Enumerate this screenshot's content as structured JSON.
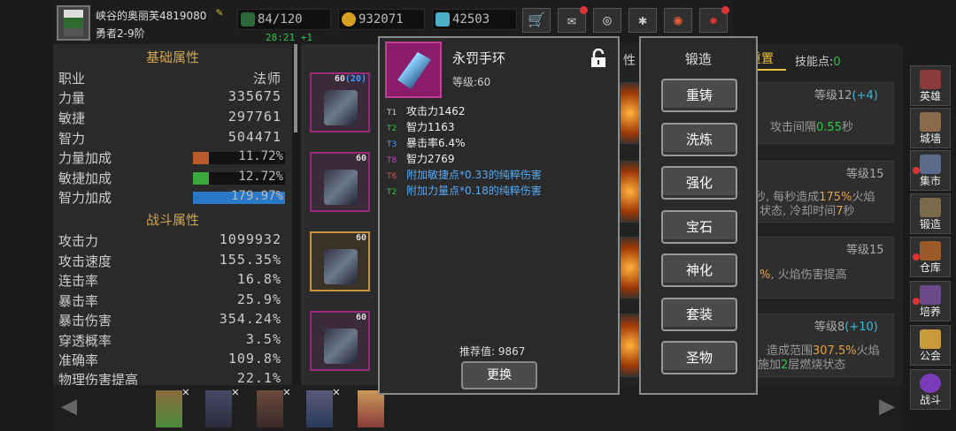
{
  "player": {
    "name": "峡谷的奥丽芙4819080",
    "rank": "勇者2-9阶"
  },
  "resources": {
    "stamina": "84/120",
    "timer": "28:21 +1",
    "gold": "932071",
    "gems": "42503"
  },
  "left": {
    "basic_title": "基础属性",
    "class_key": "职业",
    "class_val": "法师",
    "str_key": "力量",
    "str_val": "335675",
    "agi_key": "敏捷",
    "agi_val": "297761",
    "int_key": "智力",
    "int_val": "504471",
    "str_bonus_key": "力量加成",
    "str_bonus_val": "11.72%",
    "agi_bonus_key": "敏捷加成",
    "agi_bonus_val": "12.72%",
    "int_bonus_key": "智力加成",
    "int_bonus_val": "179.97%",
    "combat_title": "战斗属性",
    "atk_key": "攻击力",
    "atk_val": "1099932",
    "aspd_key": "攻击速度",
    "aspd_val": "155.35%",
    "multi_key": "连击率",
    "multi_val": "16.8%",
    "crit_key": "暴击率",
    "crit_val": "25.9%",
    "critdmg_key": "暴击伤害",
    "critdmg_val": "354.24%",
    "pen_key": "穿透概率",
    "pen_val": "3.5%",
    "acc_key": "准确率",
    "acc_val": "109.8%",
    "phys_key": "物理伤害提高",
    "phys_val": "22.1%"
  },
  "equip": {
    "slot1_lv": "60",
    "slot1_lv2": "(20)",
    "slot2_lv": "60",
    "slot3_lv": "60",
    "slot4_lv": "60"
  },
  "skills": {
    "tab_left": "性",
    "tab_reset": "重置",
    "points_label": "技能点:",
    "points_val": "0",
    "s1_level": "等级12",
    "s1_level_bonus": "(+4)",
    "s1_text_a": "攻击间隔",
    "s1_text_b": "0.55",
    "s1_text_c": "秒",
    "s2_level": "等级15",
    "s2_text1_a": "秒, 每秒造成",
    "s2_text1_b": "175%",
    "s2_text1_c": "火焰",
    "s2_text2_a": "状态, 冷却时间",
    "s2_text2_b": "7",
    "s2_text2_c": "秒",
    "s3_level": "等级15",
    "s3_text_a": "%",
    "s3_text_b": ", 火焰伤害提高",
    "s4_level": "等级8",
    "s4_level_bonus": "(+10)",
    "s4_text1_a": "造成范围",
    "s4_text1_b": "307.5%",
    "s4_text1_c": "火焰",
    "s4_text2_a": "施加",
    "s4_text2_b": "2",
    "s4_text2_c": "层燃烧状态"
  },
  "item": {
    "name": "永罚手环",
    "level": "等级:60",
    "stats": [
      {
        "tag": "T1",
        "text": "攻击力1462",
        "tag_color": "#cccccc",
        "text_color": "#eeeeee"
      },
      {
        "tag": "T2",
        "text": "智力1163",
        "tag_color": "#2fc44a",
        "text_color": "#eeeeee"
      },
      {
        "tag": "T3",
        "text": "暴击率6.4%",
        "tag_color": "#3c9cff",
        "text_color": "#eeeeee"
      },
      {
        "tag": "T8",
        "text": "智力2769",
        "tag_color": "#d040c8",
        "text_color": "#eeeeee"
      },
      {
        "tag": "T6",
        "text": "附加敏捷点*0.33的纯粹伤害",
        "tag_color": "#e04848",
        "text_color": "#58a8f0"
      },
      {
        "tag": "T2",
        "text": "附加力量点*0.18的纯粹伤害",
        "tag_color": "#2fc44a",
        "text_color": "#58a8f0"
      }
    ],
    "recommend": "推荐值: 9867",
    "swap_label": "更换"
  },
  "forge": {
    "title": "锻造",
    "buttons": [
      "重铸",
      "洗炼",
      "强化",
      "宝石",
      "神化",
      "套装",
      "圣物"
    ]
  },
  "nav": [
    "英雄",
    "城墙",
    "集市",
    "锻造",
    "仓库",
    "培养",
    "公会",
    "战斗"
  ],
  "colors": {
    "accent_gold": "#d2a44c",
    "str_bar": "#b85a2a",
    "agi_bar": "#3aa83a",
    "int_bar": "#2a78c8"
  },
  "icons": {
    "top_buttons": [
      "cart-icon",
      "mail-icon",
      "gamepad-icon",
      "gear-icon",
      "color-wheel-icon",
      "gift-icon"
    ]
  }
}
